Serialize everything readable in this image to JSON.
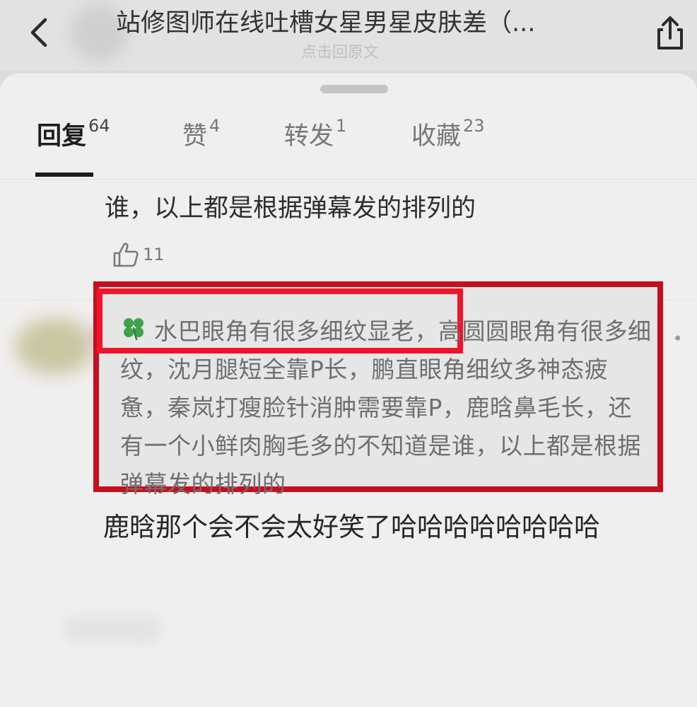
{
  "header": {
    "title": "站修图师在线吐槽女星男星皮肤差（...",
    "subtitle": "点击回原文"
  },
  "tabs": [
    {
      "label": "回复",
      "count": "64"
    },
    {
      "label": "赞",
      "count": "4"
    },
    {
      "label": "转发",
      "count": "1"
    },
    {
      "label": "收藏",
      "count": "23"
    }
  ],
  "previous_comment": {
    "text": "谁，以上都是根据弹幕发的排列的",
    "likes": "11"
  },
  "comment": {
    "quote": {
      "highlighted": "水巴眼角有很多细纹显老，",
      "line1_rest": "高圆圆眼角有很",
      "rest": "多细纹，沈月腿短全靠P长，鹏直眼角细纹多神态疲惫，秦岚打瘦脸针消肿需要靠P，鹿晗鼻毛长，还有一个小鲜肉胸毛多的不知道是谁，以上都是根据弹幕发的排列的"
    },
    "reply": "鹿晗那个会不会太好笑了哈哈哈哈哈哈哈哈"
  },
  "icons": {
    "back": "chevron-left-icon",
    "share": "share-icon",
    "like": "thumbs-up-icon",
    "more": "more-dots-icon",
    "clover": "clover-icon"
  },
  "colors": {
    "highlight_red": "#f0142a",
    "box_red": "#c60e1f",
    "clover_green": "#3fa34d"
  }
}
